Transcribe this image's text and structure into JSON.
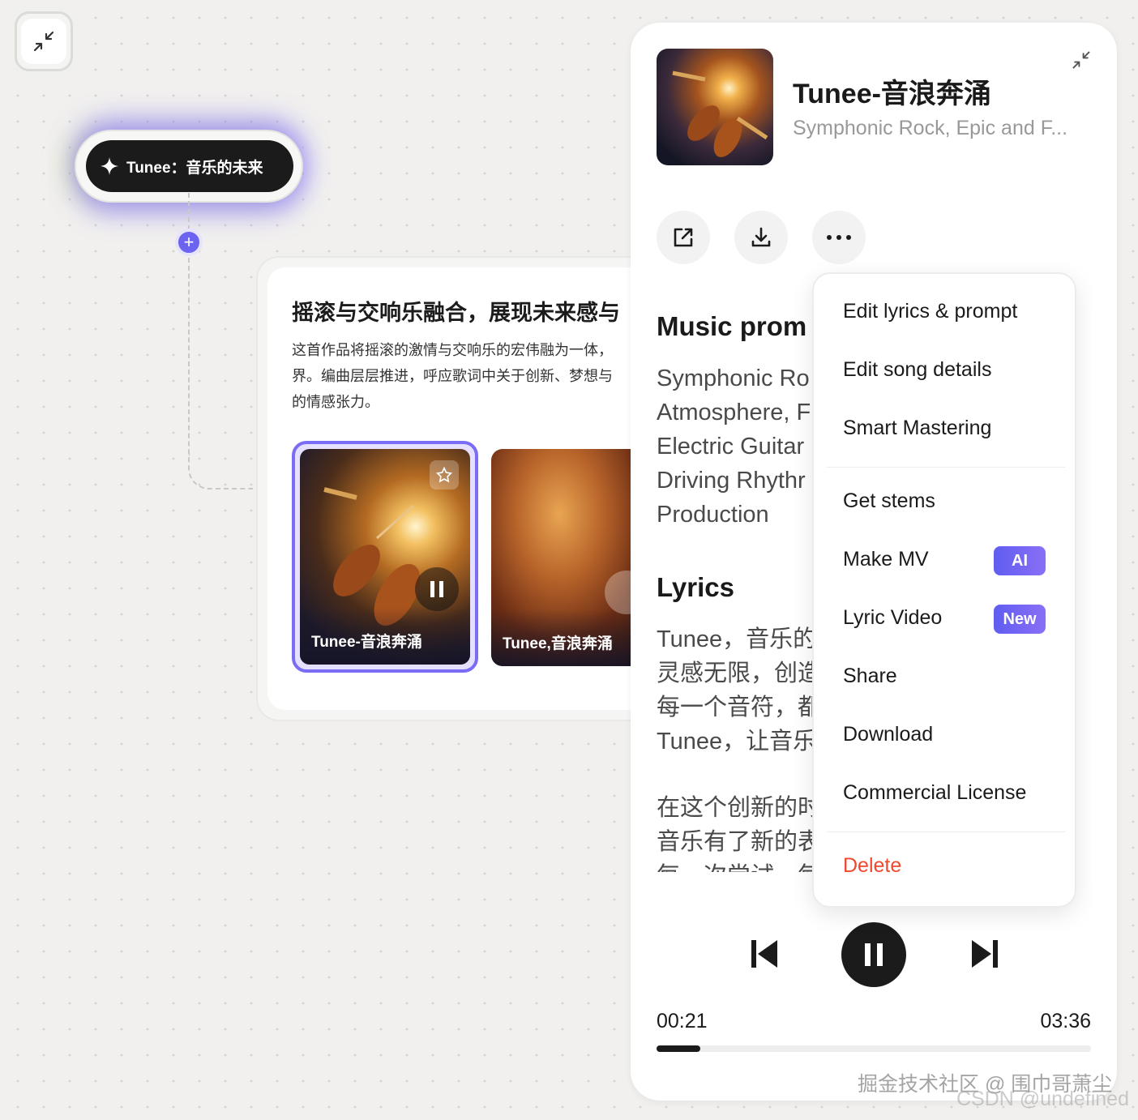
{
  "canvas": {
    "node_label": "Tunee：音乐的未来",
    "card": {
      "title": "摇滚与交响乐融合，展现未来感与",
      "desc_lines": [
        "这首作品将摇滚的激情与交响乐的宏伟融为一体，",
        "界。编曲层层推进，呼应歌词中关于创新、梦想与",
        "的情感张力。"
      ],
      "tiles": [
        {
          "label": "Tunee-音浪奔涌",
          "state": "playing"
        },
        {
          "label": "Tunee,音浪奔涌",
          "state": "paused"
        }
      ]
    }
  },
  "player": {
    "title": "Tunee-音浪奔涌",
    "subtitle": "Symphonic Rock, Epic and F...",
    "music_prompt_title": "Music prom",
    "prompt_lines": [
      "Symphonic Ro",
      "Atmosphere, F",
      "Electric Guitar",
      "Driving Rhythr",
      "Production"
    ],
    "lyrics_title": "Lyrics",
    "lyric_lines_a": [
      "Tunee，音乐的",
      "灵感无限，创造",
      "每一个音符，都",
      "Tunee，让音乐"
    ],
    "lyric_lines_b": [
      "在这个创新的时",
      "音乐有了新的表",
      "每一次尝试，每"
    ],
    "time_current": "00:21",
    "time_total": "03:36",
    "progress": 0.1
  },
  "menu": {
    "items": [
      {
        "label": "Edit lyrics & prompt"
      },
      {
        "label": "Edit song details"
      },
      {
        "label": "Smart Mastering"
      },
      {
        "label": "Get stems"
      },
      {
        "label": "Make MV",
        "badge": "AI"
      },
      {
        "label": "Lyric Video",
        "badge": "New"
      },
      {
        "label": "Share"
      },
      {
        "label": "Download"
      },
      {
        "label": "Commercial License"
      },
      {
        "label": "Delete"
      }
    ]
  },
  "watermark": {
    "line1": "掘金技术社区 @ 围巾哥萧尘",
    "line2": "CSDN @undefined"
  },
  "colors": {
    "accent": "#6c63f0",
    "danger": "#f0472f",
    "dark": "#1b1b1b"
  }
}
